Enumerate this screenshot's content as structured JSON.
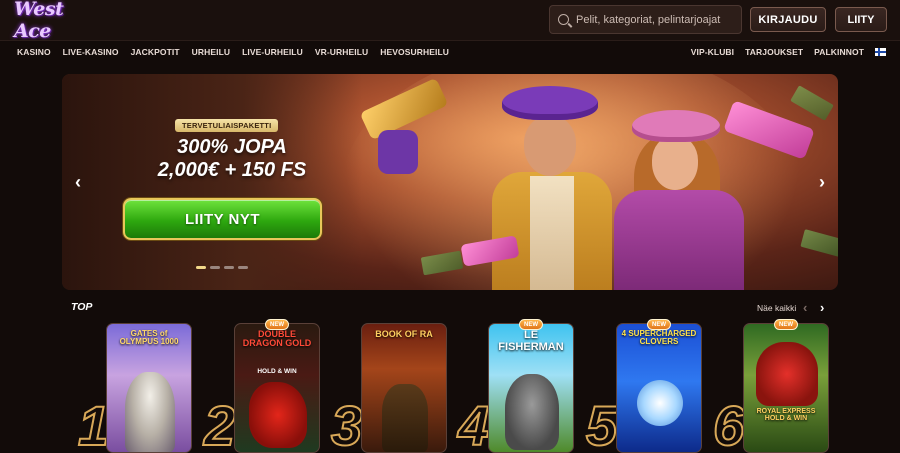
{
  "header": {
    "logo": "West Ace",
    "search": {
      "placeholder": "Pelit, kategoriat, pelintarjoajat"
    },
    "login_label": "KIRJAUDU",
    "join_label": "LIITY"
  },
  "nav": {
    "left": [
      "KASINO",
      "LIVE-KASINO",
      "JACKPOTIT",
      "URHEILU",
      "LIVE-URHEILU",
      "VR-URHEILU",
      "HEVOSURHEILU"
    ],
    "right": [
      "VIP-KLUBI",
      "TARJOUKSET",
      "PALKINNOT"
    ],
    "language_icon": "finland-flag-icon"
  },
  "hero": {
    "badge": "TERVETULIAISPAKETTI",
    "headline_line1": "300% JOPA",
    "headline_line2": "2,000€ + 150 FS",
    "cta_label": "LIITY NYT",
    "slides_total": 4,
    "active_slide": 1,
    "prev_icon": "chevron-left-icon",
    "next_icon": "chevron-right-icon"
  },
  "top": {
    "title": "TOP",
    "see_all": "Näe kaikki",
    "games": [
      {
        "rank": "1",
        "title": "GATES of OLYMPUS 1000",
        "new": false
      },
      {
        "rank": "2",
        "title": "DOUBLE DRAGON GOLD",
        "subtitle": "HOLD & WIN",
        "new": true,
        "new_label": "NEW"
      },
      {
        "rank": "3",
        "title": "BOOK OF RA",
        "new": false
      },
      {
        "rank": "4",
        "title": "LE FISHERMAN",
        "new": true,
        "new_label": "NEW"
      },
      {
        "rank": "5",
        "title": "4 SUPERCHARGED CLOVERS",
        "new": true,
        "new_label": "NEW"
      },
      {
        "rank": "6",
        "title": "ROYAL EXPRESS HOLD & WIN",
        "new": true,
        "new_label": "NEW"
      }
    ]
  },
  "colors": {
    "background": "#120b09",
    "accent_gold": "#d8a858",
    "cta_green": "#2ea80f"
  }
}
